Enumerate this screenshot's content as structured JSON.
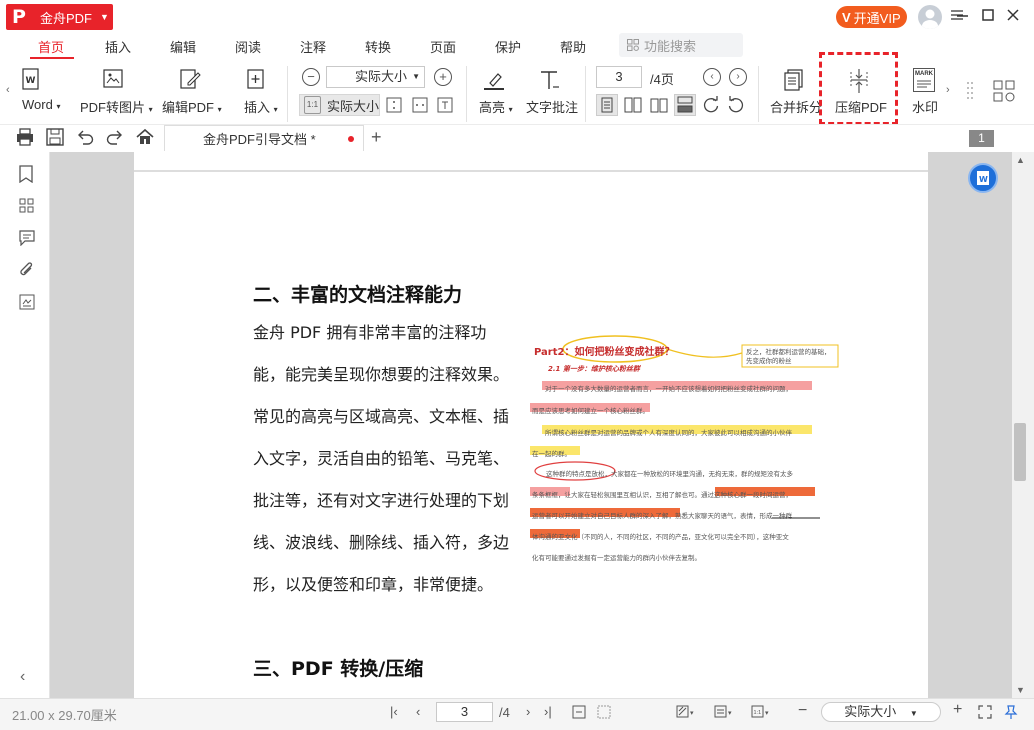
{
  "app": {
    "name": "金舟PDF",
    "vip_label": "开通VIP"
  },
  "menu": {
    "tabs": [
      "首页",
      "插入",
      "编辑",
      "阅读",
      "注释",
      "转换",
      "页面",
      "保护",
      "帮助"
    ],
    "active": "首页",
    "search_placeholder": "功能搜索"
  },
  "ribbon": {
    "word": "Word",
    "pdf_to_image": "PDF转图片",
    "edit_pdf": "编辑PDF",
    "insert": "插入",
    "zoom_select": "实际大小",
    "actual_size": "实际大小",
    "highlight": "高亮",
    "text_note": "文字批注",
    "page_current": "3",
    "page_total": "/4页",
    "merge_split": "合并拆分",
    "compress_pdf": "压缩PDF",
    "watermark": "水印",
    "watermark_icon_text": "MARK"
  },
  "doc_tab": {
    "title": "金舟PDF引导文档 *",
    "page_badge": "1"
  },
  "document": {
    "heading2": "二、丰富的文档注释能力",
    "paragraph": "金舟 PDF 拥有非常丰富的注释功能，能完美呈现你想要的注释效果。常见的高亮与区域高亮、文本框、插入文字，灵活自由的铅笔、马克笔、批注等，还有对文字进行处理的下划线、波浪线、删除线、插入符，多边形，以及便签和印章，非常便捷。",
    "paragraph_lines": [
      "金舟 PDF 拥有非常丰富的注释功",
      "能，能完美呈现你想要的注释效果。",
      "常见的高亮与区域高亮、文本框、插",
      "入文字，灵活自由的铅笔、马克笔、",
      "批注等，还有对文字进行处理的下划",
      "线、波浪线、删除线、插入符，多边",
      "形，以及便签和印章，非常便捷。"
    ],
    "heading3": "三、PDF 转换/压缩",
    "annotation_image": {
      "title": "Part2：如何把粉丝变成社群？",
      "subtitle": "2.1 第一步：维护核心粉丝群",
      "callout": "反之，社群都利运营的基础，先变成你的粉丝",
      "lines": [
        "对于一个没有多大数量的运营者而言，一开始不应该想着如何把粉丝变成社群的问题，",
        "而是应该思考如何建立一个核心粉丝群。",
        "所谓核心粉丝群是对运营的品牌或个人有深度认同的，大家彼此可以相成沟通的小伙伴",
        "在一起的群。",
        "这种群的特点是放松，大家都在一种放松的环境里沟通，无拘无束，群的规矩没有太多",
        "条条框框，让大家在轻松氛围里互相认识，互相了解也可。通过这种核心群一段时间运营，",
        "运营者可以开始建立对自己目标人群的深入了解，熟悉大家聊天的语气，表情，形成一种群",
        "体沟通的亚文化（不同的人，不同的社区，不同的产品，亚文化可以完全不同），这种亚文",
        "化有可能要通过发掘有一定运营能力的群内小伙伴去复制。"
      ]
    }
  },
  "status": {
    "page_size": "21.00 x 29.70厘米",
    "page_current": "3",
    "page_total": "/4",
    "zoom": "实际大小"
  },
  "colors": {
    "brand": "#e8232a",
    "vip": "#f25c1e",
    "arrow": "#e8232a"
  }
}
